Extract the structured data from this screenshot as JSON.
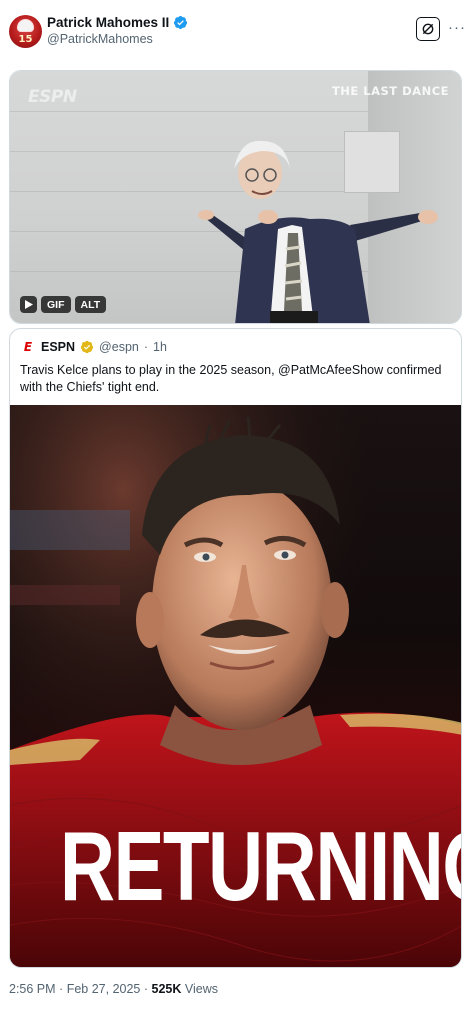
{
  "author": {
    "display_name": "Patrick Mahomes II",
    "handle": "@PatrickMahomes",
    "avatar_number": "15",
    "verified_color": "#1d9bf0"
  },
  "gif": {
    "watermark": "ESPN",
    "overlay_title": "THE LAST DANCE",
    "gif_badge": "GIF",
    "alt_badge": "ALT"
  },
  "quoted": {
    "name": "ESPN",
    "handle": "@espn",
    "dot": "·",
    "time": "1h",
    "text": "Travis Kelce plans to play in the 2025 season, @PatMcAfeeShow confirmed with the Chiefs' tight end.",
    "image_caption": "RETURNING",
    "verified_color": "#e2b719",
    "avatar_letter": "E"
  },
  "footer": {
    "time": "2:56 PM",
    "sep1": "·",
    "date": "Feb 27, 2025",
    "sep2": "·",
    "views_count": "525K",
    "views_label": "Views"
  }
}
